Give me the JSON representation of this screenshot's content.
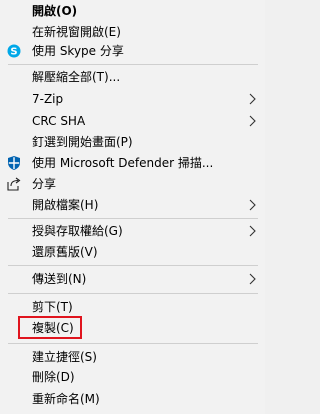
{
  "menu": {
    "items": [
      {
        "label": "開啟(O)"
      },
      {
        "label": "在新視窗開啟(E)"
      },
      {
        "label": "使用 Skype 分享",
        "icon": "skype-icon"
      },
      {
        "label": "解壓縮全部(T)..."
      },
      {
        "label": "7-Zip",
        "submenu": true
      },
      {
        "label": "CRC SHA",
        "submenu": true
      },
      {
        "label": "釘選到開始畫面(P)"
      },
      {
        "label": "使用 Microsoft Defender 掃描...",
        "icon": "defender-shield-icon"
      },
      {
        "label": "分享",
        "icon": "share-icon"
      },
      {
        "label": "開啟檔案(H)",
        "submenu": true
      },
      {
        "label": "授與存取權給(G)",
        "submenu": true
      },
      {
        "label": "還原舊版(V)"
      },
      {
        "label": "傳送到(N)",
        "submenu": true
      },
      {
        "label": "剪下(T)"
      },
      {
        "label": "複製(C)",
        "highlighted": true
      },
      {
        "label": "建立捷徑(S)"
      },
      {
        "label": "刪除(D)"
      },
      {
        "label": "重新命名(M)"
      }
    ]
  },
  "colors": {
    "background": "#f2f2f2",
    "separator": "#cfcfcf",
    "highlight_border": "#e0141e",
    "skype_blue": "#00a8e8",
    "defender_blue": "#0063b1"
  }
}
